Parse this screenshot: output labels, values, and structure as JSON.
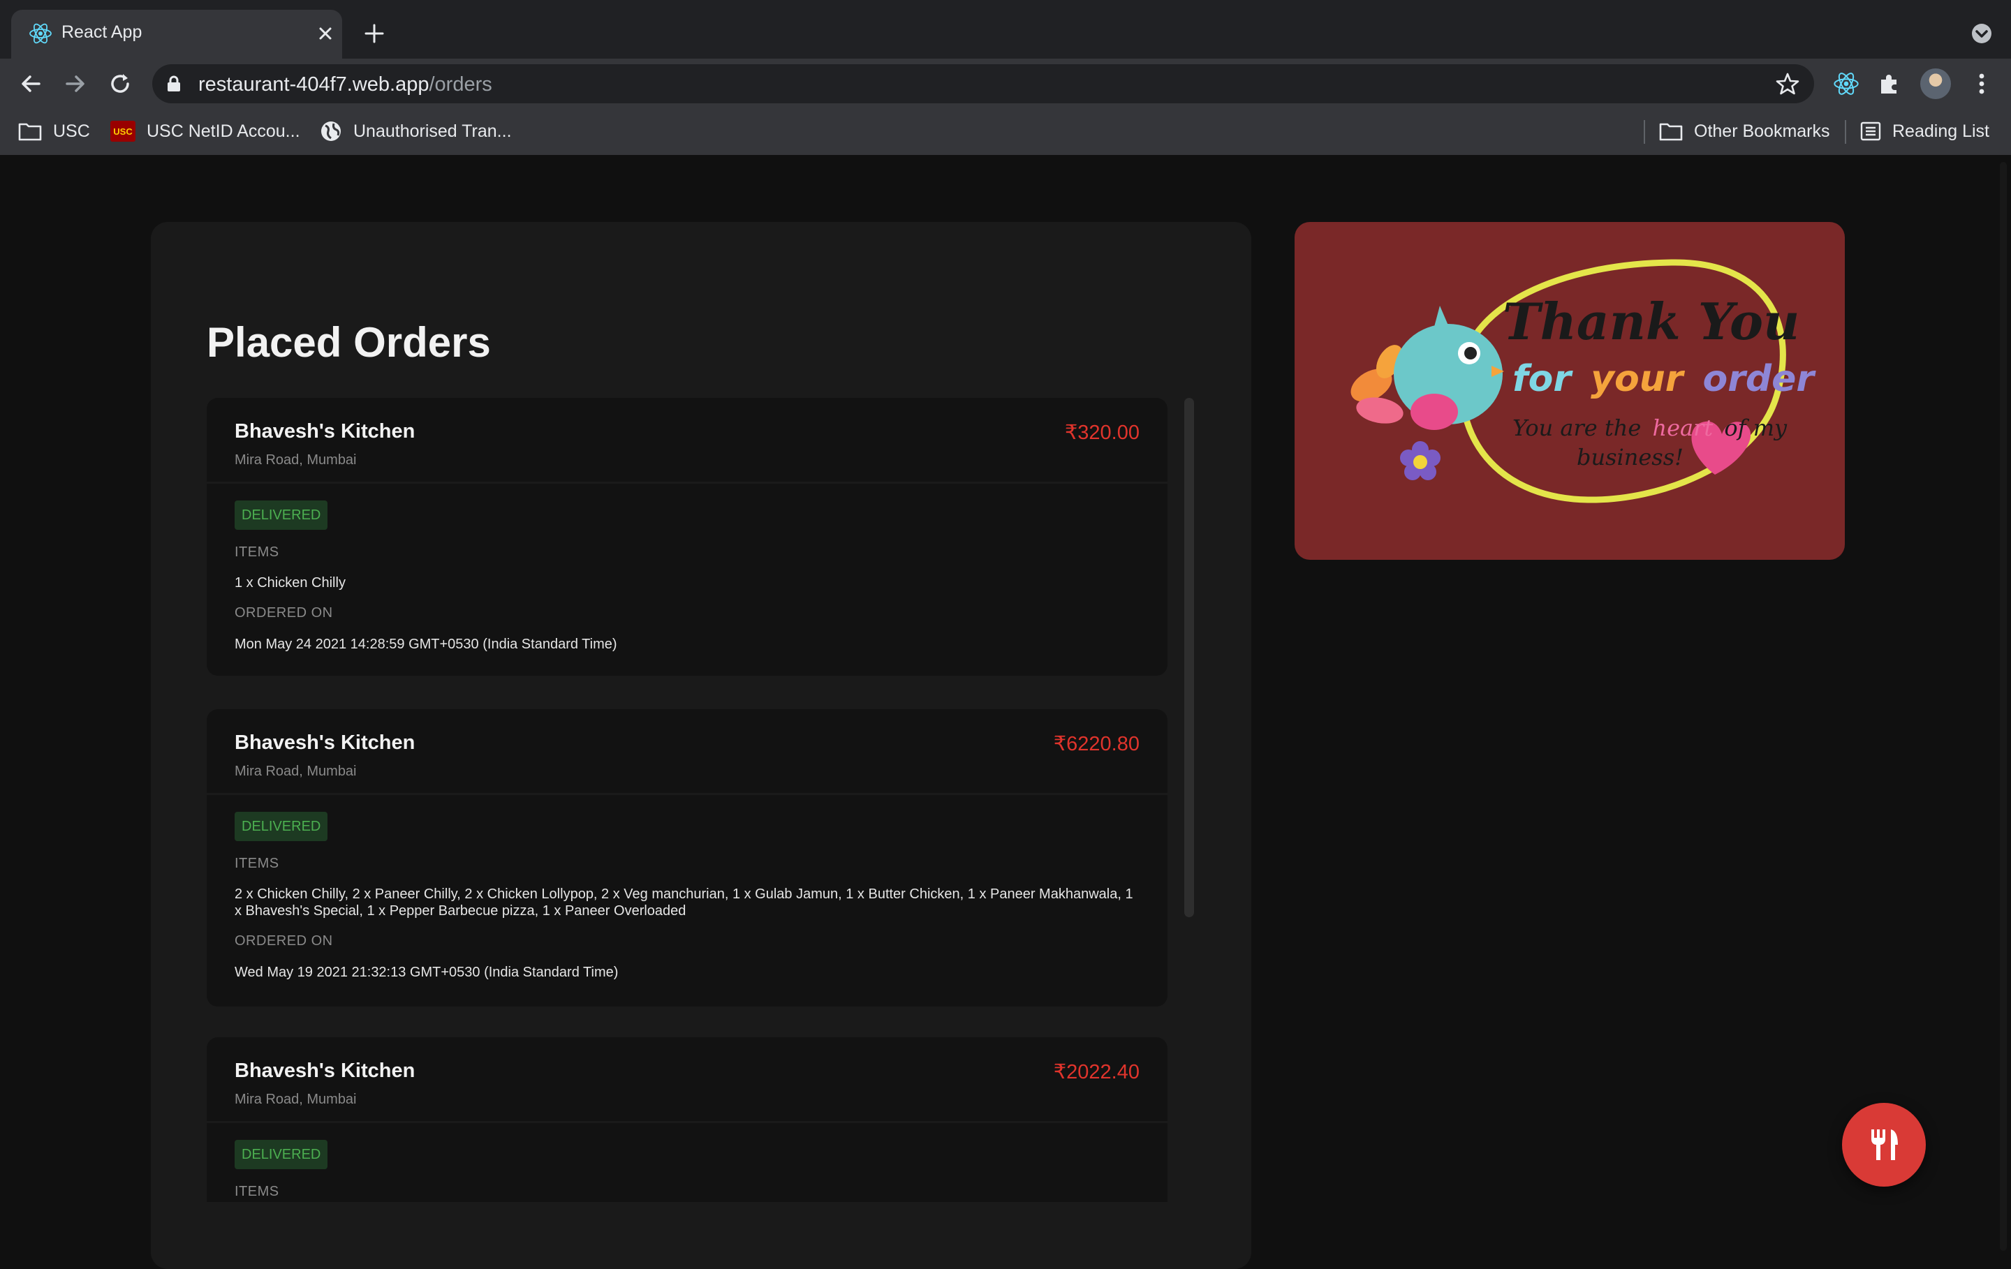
{
  "browser": {
    "tab": {
      "title": "React App",
      "favicon": "react-icon"
    },
    "url": {
      "host": "restaurant-404f7.web.app",
      "path": "/orders"
    },
    "bookmarks": [
      {
        "label": "USC",
        "icon": "folder-icon"
      },
      {
        "label": "USC NetID Accou...",
        "icon": "usc-icon"
      },
      {
        "label": "Unauthorised Tran...",
        "icon": "globe-icon"
      }
    ],
    "other_bookmarks": "Other Bookmarks",
    "reading_list": "Reading List"
  },
  "page": {
    "title": "Placed Orders",
    "labels": {
      "items": "ITEMS",
      "ordered_on": "ORDERED ON"
    },
    "orders": [
      {
        "restaurant": "Bhavesh's Kitchen",
        "location": "Mira Road, Mumbai",
        "price": "₹320.00",
        "status": "DELIVERED",
        "items": "1 x Chicken Chilly",
        "ordered_on": "Mon May 24 2021 14:28:59 GMT+0530 (India Standard Time)"
      },
      {
        "restaurant": "Bhavesh's Kitchen",
        "location": "Mira Road, Mumbai",
        "price": "₹6220.80",
        "status": "DELIVERED",
        "items": "2 x Chicken Chilly, 2 x Paneer Chilly, 2 x Chicken Lollypop, 2 x Veg manchurian, 1 x Gulab Jamun, 1 x Butter Chicken, 1 x Paneer Makhanwala, 1 x Bhavesh's Special, 1 x Pepper Barbecue pizza, 1 x Paneer Overloaded",
        "ordered_on": "Wed May 19 2021 21:32:13 GMT+0530 (India Standard Time)"
      },
      {
        "restaurant": "Bhavesh's Kitchen",
        "location": "Mira Road, Mumbai",
        "price": "₹2022.40",
        "status": "DELIVERED"
      }
    ],
    "thank_you_card": {
      "line1": "Thank You",
      "line2_for": "for",
      "line2_your": "your",
      "line2_order": "order",
      "line3_a": "You are the",
      "line3_heart": "heart",
      "line3_b": "of my",
      "line4": "business!"
    },
    "fab_icon": "restaurant-icon"
  },
  "colors": {
    "page_bg": "#101010",
    "panel_bg": "#1a1a1a",
    "card_bg": "#121212",
    "price": "#e0342c",
    "status_green": "#4caf50",
    "thank_bg": "#7a2828",
    "fab": "#d93a36"
  }
}
